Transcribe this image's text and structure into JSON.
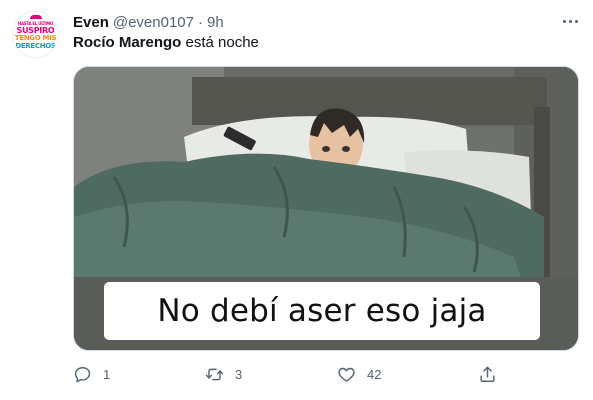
{
  "tweet": {
    "author": {
      "display_name": "Even",
      "handle": "@even0107",
      "separator": "·",
      "time": "9h",
      "avatar_lines": [
        "HASTA EL ULTIMO",
        "SUSPIRO",
        "TENGO MIS",
        "DERECHOS"
      ]
    },
    "mention": "Rocío Marengo",
    "text_after_mention": " está noche",
    "media": {
      "caption": "No debí aser eso jaja"
    },
    "actions": {
      "reply_count": "1",
      "retweet_count": "3",
      "like_count": "42"
    }
  },
  "icons": {
    "more": "more-horizontal-icon",
    "reply": "reply-icon",
    "retweet": "retweet-icon",
    "like": "like-icon",
    "share": "share-icon"
  },
  "colors": {
    "text_primary": "#0f1419",
    "text_secondary": "#536471",
    "border": "#cfd9de",
    "avatar_pink": "#e6007e",
    "avatar_orange": "#f39200",
    "avatar_blue": "#009fe3"
  }
}
